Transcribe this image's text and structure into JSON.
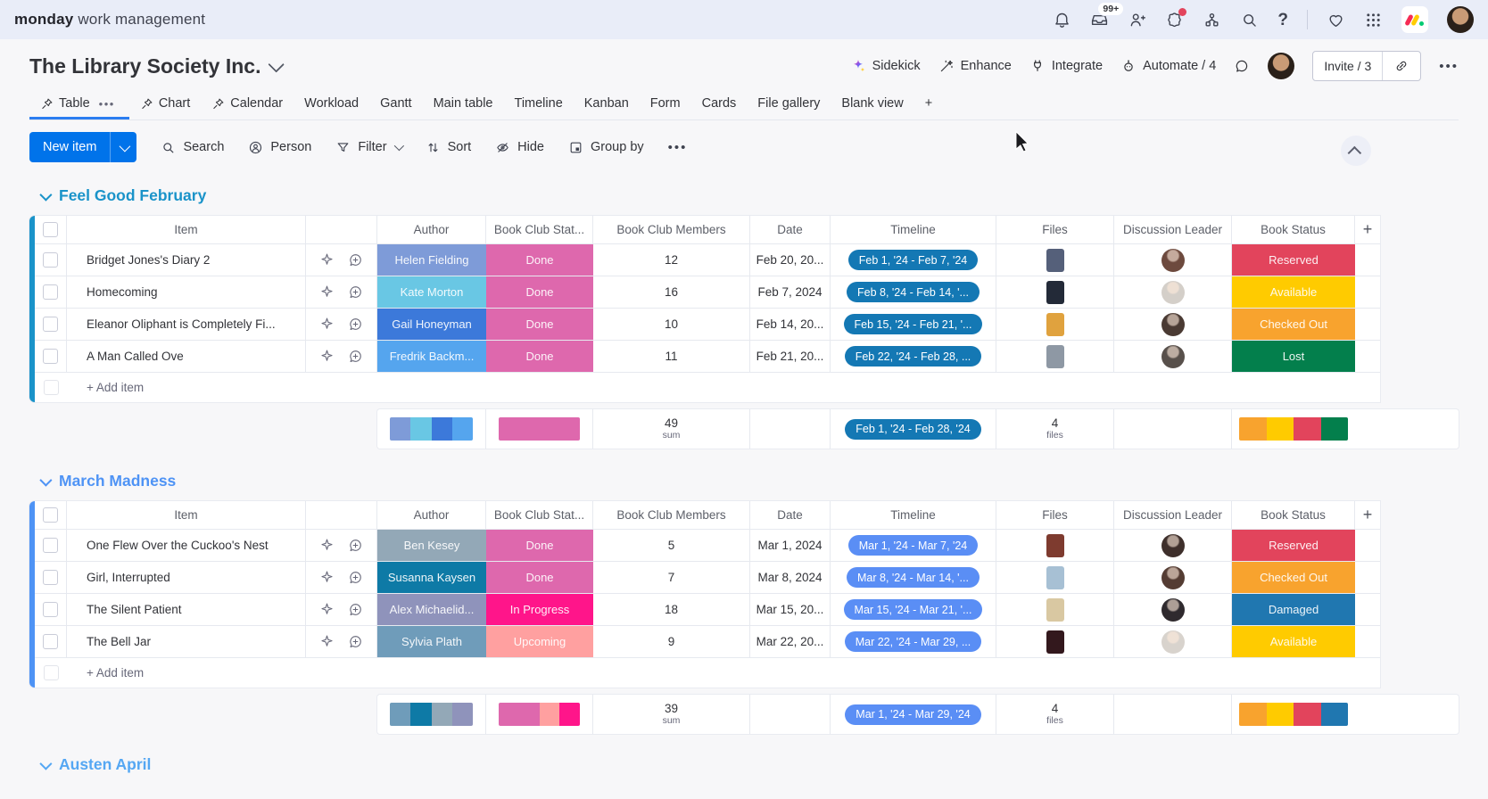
{
  "topbar": {
    "logo_bold": "monday",
    "logo_rest": "work management",
    "inbox_badge": "99+"
  },
  "header": {
    "title": "The Library Society Inc.",
    "sidekick": "Sidekick",
    "enhance": "Enhance",
    "integrate": "Integrate",
    "automate": "Automate / 4",
    "invite": "Invite / 3",
    "more": "•••"
  },
  "tabs": [
    {
      "label": "Table"
    },
    {
      "label": "Chart"
    },
    {
      "label": "Calendar"
    },
    {
      "label": "Workload"
    },
    {
      "label": "Gantt"
    },
    {
      "label": "Main table"
    },
    {
      "label": "Timeline"
    },
    {
      "label": "Kanban"
    },
    {
      "label": "Form"
    },
    {
      "label": "Cards"
    },
    {
      "label": "File gallery"
    },
    {
      "label": "Blank view"
    },
    {
      "label": "+"
    }
  ],
  "toolbar": {
    "new_item": "New item",
    "search": "Search",
    "person": "Person",
    "filter": "Filter",
    "sort": "Sort",
    "hide": "Hide",
    "group_by": "Group by",
    "more": "•••"
  },
  "columns": {
    "item": "Item",
    "author": "Author",
    "status": "Book Club Stat...",
    "members": "Book Club Members",
    "date": "Date",
    "timeline": "Timeline",
    "files": "Files",
    "leader": "Discussion Leader",
    "book": "Book Status",
    "add_column": "+"
  },
  "groups": [
    {
      "name": "Feel Good February",
      "color": "#1a93c9",
      "timeline_color": "#1478b4",
      "add_item": "+ Add item",
      "rows": [
        {
          "item": "Bridget Jones's Diary 2",
          "author": "Helen Fielding",
          "author_color": "#7e9bd8",
          "status": "Done",
          "status_color": "#de68ad",
          "members": "12",
          "date": "Feb 20, 20...",
          "timeline": "Feb 1, '24 - Feb 7, '24",
          "file_color": "#55607a",
          "leader_color": "#6d4a3e",
          "book_status": "Reserved",
          "book_color": "#e2445c"
        },
        {
          "item": "Homecoming",
          "author": "Kate Morton",
          "author_color": "#69c7e4",
          "status": "Done",
          "status_color": "#de68ad",
          "members": "16",
          "date": "Feb 7, 2024",
          "timeline": "Feb 8, '24 - Feb 14, '...",
          "file_color": "#232a38",
          "leader_color": "#d4cfc9",
          "book_status": "Available",
          "book_color": "#ffcb00"
        },
        {
          "item": "Eleanor Oliphant is Completely Fi...",
          "author": "Gail Honeyman",
          "author_color": "#3c79da",
          "status": "Done",
          "status_color": "#de68ad",
          "members": "10",
          "date": "Feb 14, 20...",
          "timeline": "Feb 15, '24 - Feb 21, '...",
          "file_color": "#e0a23e",
          "leader_color": "#4a3a33",
          "book_status": "Checked Out",
          "book_color": "#f8a32e"
        },
        {
          "item": "A Man Called Ove",
          "author": "Fredrik Backm...",
          "author_color": "#55a5ee",
          "status": "Done",
          "status_color": "#de68ad",
          "members": "11",
          "date": "Feb 21, 20...",
          "timeline": "Feb 22, '24 - Feb 28, ...",
          "file_color": "#8e98a4",
          "leader_color": "#58504b",
          "book_status": "Lost",
          "book_color": "#037f4c"
        }
      ],
      "summary": {
        "sum": "49",
        "sum_label": "sum",
        "timeline": "Feb 1, '24 - Feb 28, '24",
        "files": "4",
        "files_label": "files",
        "author_bar": [
          {
            "c": "#7e9bd8",
            "w": 1
          },
          {
            "c": "#69c7e4",
            "w": 1
          },
          {
            "c": "#3c79da",
            "w": 1
          },
          {
            "c": "#55a5ee",
            "w": 1
          }
        ],
        "status_bar": [
          {
            "c": "#de68ad",
            "w": 1
          }
        ],
        "book_bar": [
          {
            "c": "#f8a32e",
            "w": 1
          },
          {
            "c": "#ffcb00",
            "w": 1
          },
          {
            "c": "#e2445c",
            "w": 1
          },
          {
            "c": "#037f4c",
            "w": 1
          }
        ]
      }
    },
    {
      "name": "March Madness",
      "color": "#4e93f5",
      "timeline_color": "#5a8ef5",
      "add_item": "+ Add item",
      "rows": [
        {
          "item": "One Flew Over the Cuckoo's Nest",
          "author": "Ben Kesey",
          "author_color": "#93a8b7",
          "status": "Done",
          "status_color": "#de68ad",
          "members": "5",
          "date": "Mar 1, 2024",
          "timeline": "Mar 1, '24 - Mar 7, '24",
          "file_color": "#7e3b2f",
          "leader_color": "#3e2f2b",
          "book_status": "Reserved",
          "book_color": "#e2445c"
        },
        {
          "item": "Girl, Interrupted",
          "author": "Susanna Kaysen",
          "author_color": "#0e7aa6",
          "status": "Done",
          "status_color": "#de68ad",
          "members": "7",
          "date": "Mar 8, 2024",
          "timeline": "Mar 8, '24 - Mar 14, '...",
          "file_color": "#a7c0d4",
          "leader_color": "#543c33",
          "book_status": "Checked Out",
          "book_color": "#f8a32e"
        },
        {
          "item": "The Silent Patient",
          "author": "Alex Michaelid...",
          "author_color": "#8f93bb",
          "status": "In Progress",
          "status_color": "#ff158a",
          "members": "18",
          "date": "Mar 15, 20...",
          "timeline": "Mar 15, '24 - Mar 21, '...",
          "file_color": "#d9c8a2",
          "leader_color": "#2f2a2e",
          "book_status": "Damaged",
          "book_color": "#2077b0"
        },
        {
          "item": "The Bell Jar",
          "author": "Sylvia Plath",
          "author_color": "#6f9cba",
          "status": "Upcoming",
          "status_color": "#ffa0a0",
          "members": "9",
          "date": "Mar 22, 20...",
          "timeline": "Mar 22, '24 - Mar 29, ...",
          "file_color": "#33181d",
          "leader_color": "#d8d3cd",
          "book_status": "Available",
          "book_color": "#ffcb00"
        }
      ],
      "summary": {
        "sum": "39",
        "sum_label": "sum",
        "timeline": "Mar 1, '24 - Mar 29, '24",
        "files": "4",
        "files_label": "files",
        "author_bar": [
          {
            "c": "#6f9cba",
            "w": 1
          },
          {
            "c": "#0e7aa6",
            "w": 1
          },
          {
            "c": "#93a8b7",
            "w": 1
          },
          {
            "c": "#8f93bb",
            "w": 1
          }
        ],
        "status_bar": [
          {
            "c": "#de68ad",
            "w": 2
          },
          {
            "c": "#ffa0a0",
            "w": 1
          },
          {
            "c": "#ff158a",
            "w": 1
          }
        ],
        "book_bar": [
          {
            "c": "#f8a32e",
            "w": 1
          },
          {
            "c": "#ffcb00",
            "w": 1
          },
          {
            "c": "#e2445c",
            "w": 1
          },
          {
            "c": "#2077b0",
            "w": 1
          }
        ]
      }
    },
    {
      "name": "Austen April",
      "color": "#55a7f3"
    }
  ]
}
